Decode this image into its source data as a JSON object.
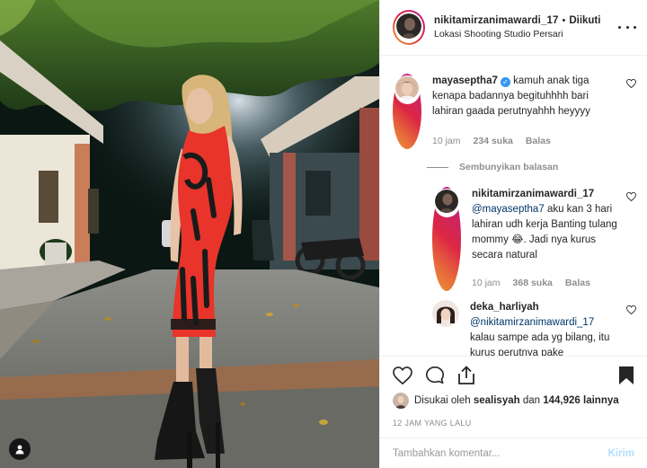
{
  "post": {
    "author": "nikitamirzanimawardi_17",
    "follow_state": "Diikuti",
    "separator": "•",
    "location": "Lokasi Shooting Studio Persari"
  },
  "comments": [
    {
      "username": "mayaseptha7",
      "verified": true,
      "text": "kamuh anak tiga kenapa badannya begituhhhh bari lahiran gaada perutnyahhh heyyyy",
      "time": "10 jam",
      "likes": "234 suka",
      "reply": "Balas"
    }
  ],
  "hide_replies": "Sembunyikan balasan",
  "replies": [
    {
      "username": "nikitamirzanimawardi_17",
      "mention": "@mayaseptha7",
      "text": "aku kan 3 hari lahiran udh kerja Banting tulang mommy 😂. Jadi nya kurus secara natural",
      "time": "10 jam",
      "likes": "368 suka",
      "reply": "Balas"
    },
    {
      "username": "deka_harliyah",
      "mention": "@nikitamirzanimawardi_17",
      "text": "kalau sampe ada yg bilang, itu kurus perutnya pake"
    }
  ],
  "likes": {
    "prefix": "Disukai oleh",
    "user": "sealisyah",
    "and": "dan",
    "count": "144,926 lainnya"
  },
  "time_ago": "12 JAM YANG LALU",
  "composer": {
    "placeholder": "Tambahkan komentar...",
    "post_label": "Kirim"
  },
  "icons": {
    "like": "heart-icon",
    "comment": "comment-icon",
    "share": "share-icon",
    "save": "bookmark-icon",
    "more": "more-options-icon",
    "tagged": "user-tag-icon"
  },
  "colors": {
    "text": "#262626",
    "muted": "#8e8e8e",
    "mention": "#003569",
    "verified": "#3897f0",
    "post_button": "#b2dffc",
    "dress": "#e8342a"
  }
}
